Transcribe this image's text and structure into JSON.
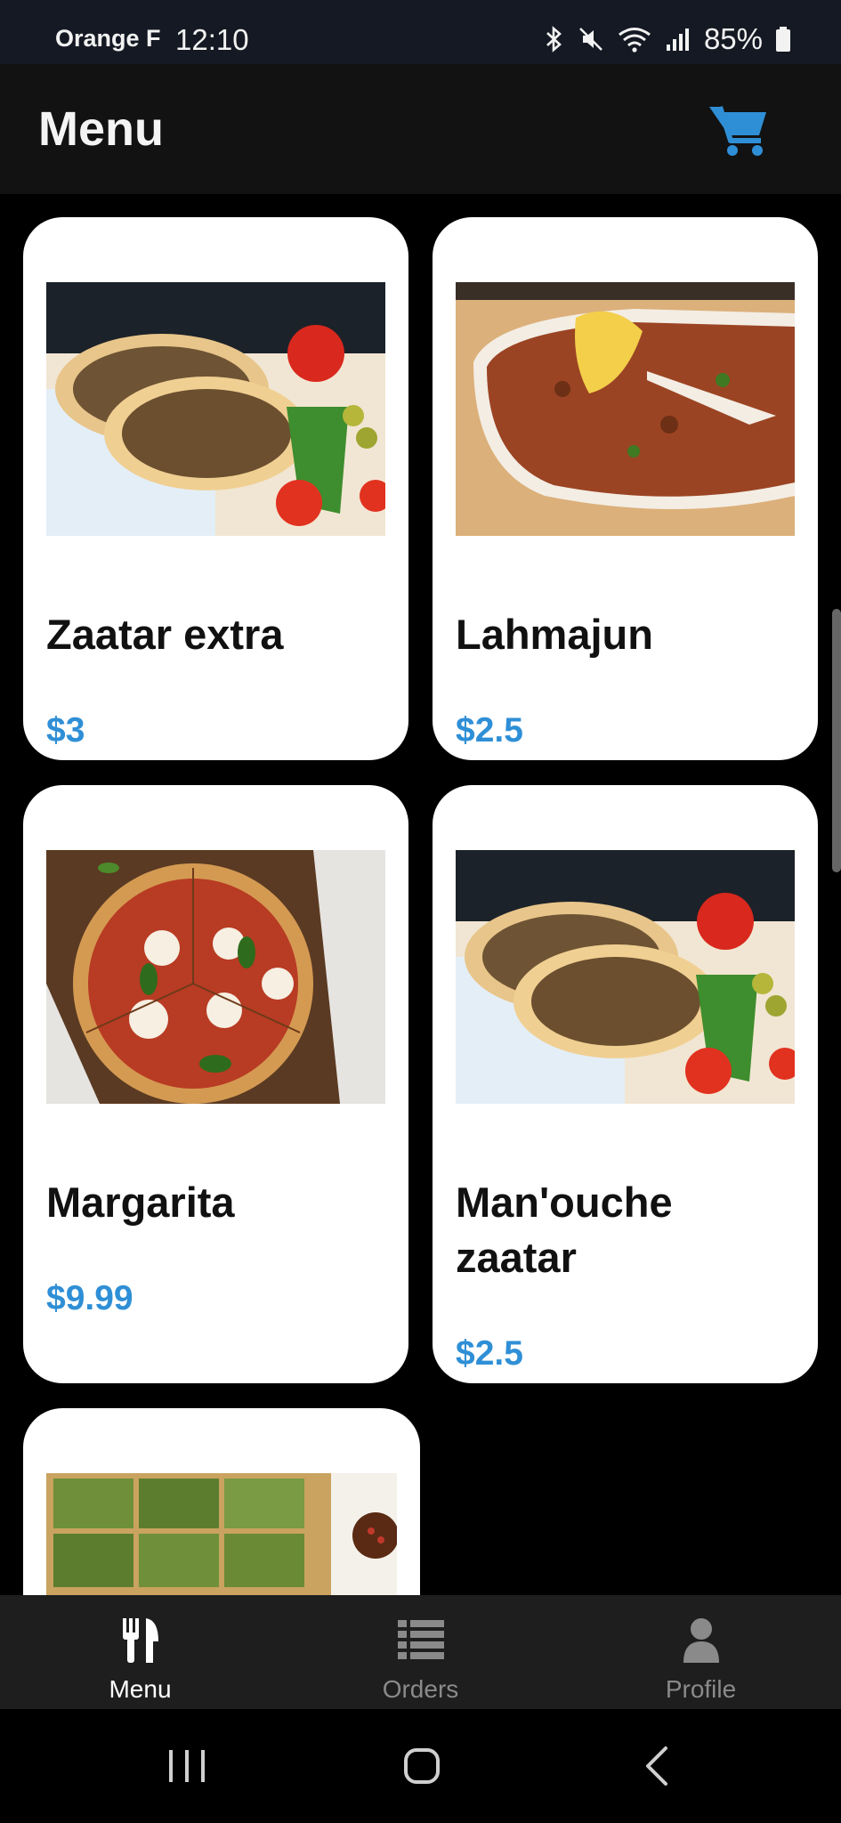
{
  "status_bar": {
    "carrier": "Orange F",
    "time": "12:10",
    "battery": "85%",
    "icons": [
      "bluetooth-icon",
      "mute-icon",
      "wifi-icon",
      "signal-icon",
      "battery-icon"
    ]
  },
  "header": {
    "title": "Menu",
    "cart_icon": "cart-icon",
    "accent": "#2f8fd6"
  },
  "menu": {
    "items": [
      {
        "name": "Zaatar extra",
        "price": "$3",
        "image": "zaatar-flatbread-photo"
      },
      {
        "name": "Lahmajun",
        "price": "$2.5",
        "image": "lahmajun-photo"
      },
      {
        "name": "Margarita",
        "price": "$9.99",
        "image": "margarita-pizza-photo"
      },
      {
        "name": "Man'ouche zaatar",
        "price": "$2.5",
        "image": "zaatar-flatbread-photo"
      },
      {
        "name": "",
        "price": "",
        "image": "spinach-pizza-photo"
      }
    ]
  },
  "bottom_nav": {
    "tabs": [
      {
        "label": "Menu",
        "icon": "utensils-icon",
        "active": true
      },
      {
        "label": "Orders",
        "icon": "list-icon",
        "active": false
      },
      {
        "label": "Profile",
        "icon": "user-icon",
        "active": false
      }
    ]
  },
  "system_nav": [
    "recents-icon",
    "home-icon",
    "back-icon"
  ]
}
